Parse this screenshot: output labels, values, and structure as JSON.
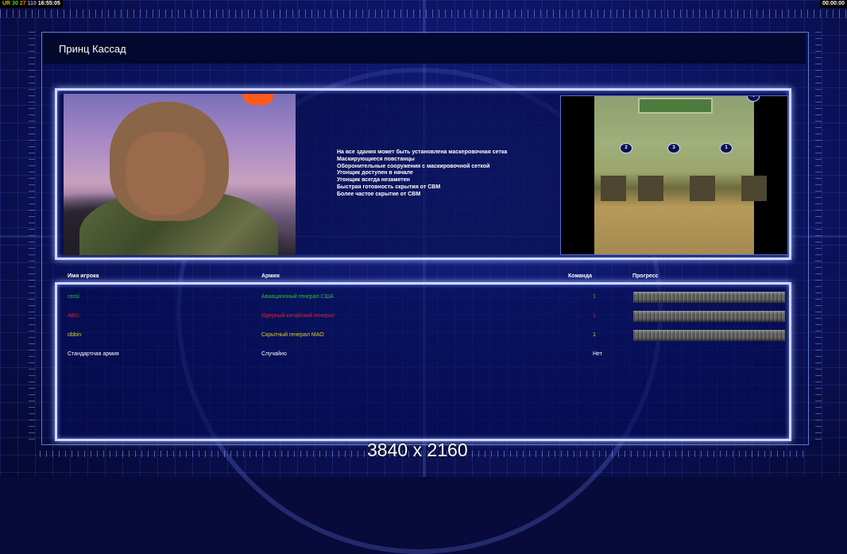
{
  "status": {
    "left": {
      "a": "UR",
      "b": "30",
      "c": "27",
      "d": "110",
      "time": "16:55:05"
    },
    "right": "00:00:00"
  },
  "title": "Принц Кассад",
  "description": [
    "На все здания может быть установлена маскеровочная сетка",
    "Маскирующиеся повстанцы",
    "Оборонительные сооружения с маскировочной сеткой",
    "Угонщик доступен в начале",
    "Угонщик всегда незаметен",
    "Быстрая готовность скрытия от СВМ",
    "Более частое скрытие от СВМ"
  ],
  "map": {
    "markers": [
      "1",
      "2",
      "3",
      "4"
    ]
  },
  "table": {
    "headers": {
      "name": "Имя игрока",
      "army": "Армия",
      "team": "Команда",
      "progress": "Прогресс"
    },
    "rows": [
      {
        "name": "rossi",
        "army": "Авиационный генерал США",
        "team": "1",
        "color": "#2fbf2f",
        "progress": 1.0
      },
      {
        "name": "ABU",
        "army": "Ядерный китайский генерал",
        "team": "1",
        "color": "#e02020",
        "progress": 1.0
      },
      {
        "name": "obbin",
        "army": "Скрытный генерал МАО",
        "team": "1",
        "color": "#d8d020",
        "progress": 1.0
      },
      {
        "name": "Стандартная армия",
        "army": "Случайно",
        "team": "Нет",
        "color": "#ffffff"
      }
    ]
  },
  "resolution_label": "3840 x 2160"
}
